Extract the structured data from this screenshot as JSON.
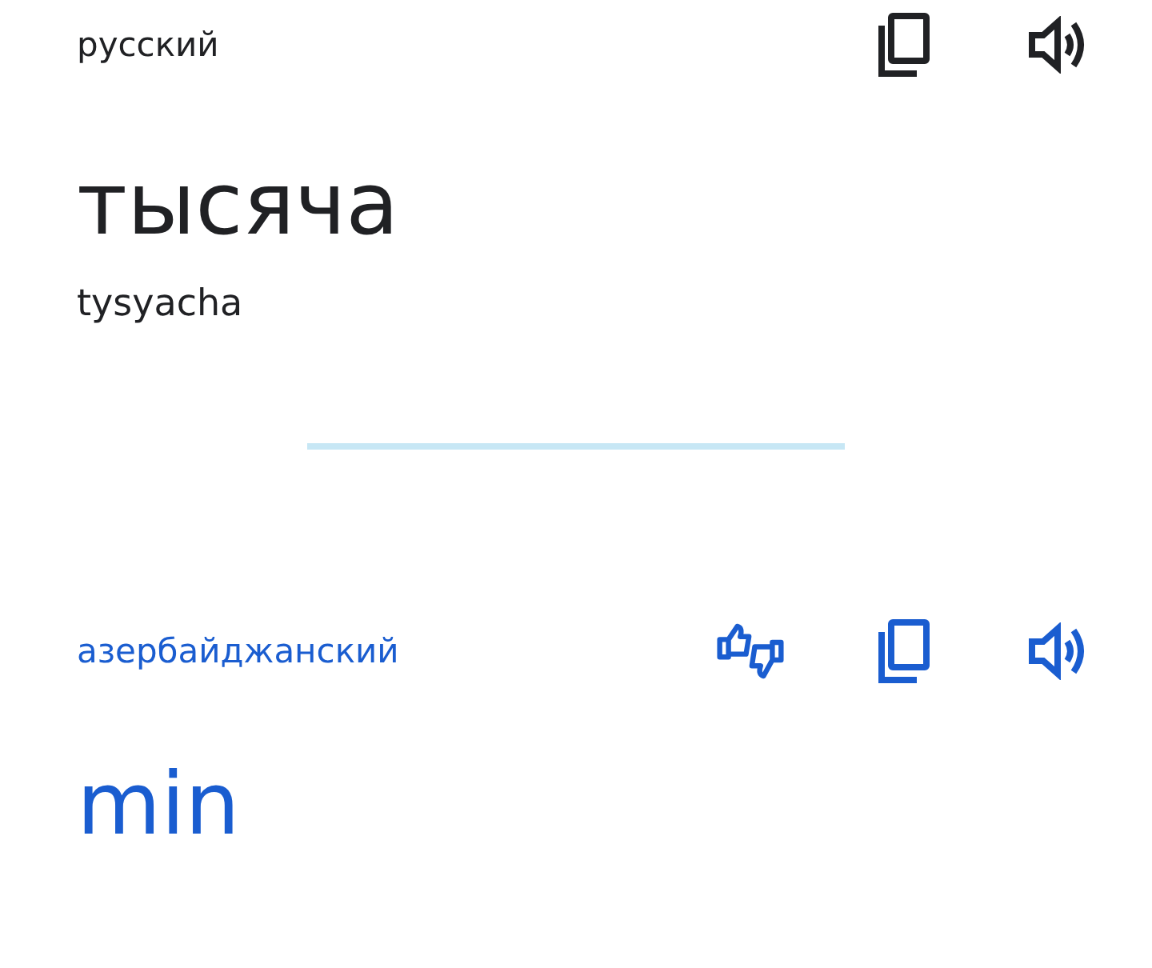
{
  "source": {
    "language": "русский",
    "text": "тысяча",
    "transliteration": "tysyacha"
  },
  "target": {
    "language": "азербайджанский",
    "text": "min"
  }
}
